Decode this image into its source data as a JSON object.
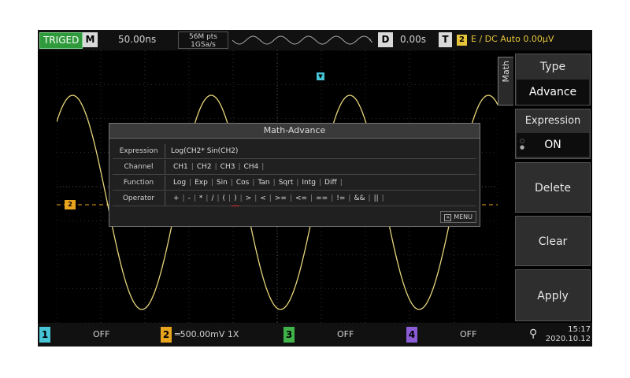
{
  "topbar": {
    "status": "TRIGED",
    "mode": "M",
    "timebase": "50.00ns",
    "points": "56M pts",
    "sample_rate": "1GSa/s",
    "d_label": "D",
    "delay": "0.00s",
    "t_label": "T",
    "trigger_channel": "2",
    "trigger_info": "E ∕ DC Auto 0.00μV"
  },
  "dialog": {
    "title": "Math-Advance",
    "rows": [
      {
        "label": "Expression",
        "value": "Log(CH2* Sin(CH2)"
      },
      {
        "label": "Channel",
        "tokens": [
          "CH1",
          "CH2",
          "CH3",
          "CH4"
        ]
      },
      {
        "label": "Function",
        "tokens": [
          "Log",
          "Exp",
          "Sin",
          "Cos",
          "Tan",
          "Sqrt",
          "Intg",
          "Diff"
        ]
      },
      {
        "label": "Operator",
        "tokens": [
          "+",
          "-",
          "*",
          "/",
          "(",
          ")",
          ">",
          "<",
          ">=",
          "<=",
          "==",
          "!=",
          "&&",
          "||"
        ],
        "selected_index": 5
      }
    ],
    "menu_label": "MENU"
  },
  "side_menu": {
    "tab": "Math",
    "items": [
      {
        "label": "Type",
        "value": "Advance"
      },
      {
        "label": "Expression",
        "value": "ON"
      },
      {
        "label": "Delete"
      },
      {
        "label": "Clear"
      },
      {
        "label": "Apply"
      }
    ]
  },
  "waveform": {
    "ch2_marker": "2",
    "color": "#e6d57a"
  },
  "bottombar": {
    "channels": [
      {
        "num": "1",
        "status": "OFF",
        "color": "#47c4d6"
      },
      {
        "num": "2",
        "status": "═500.00mV 1X",
        "color": "#e8a41e"
      },
      {
        "num": "3",
        "status": "OFF",
        "color": "#3fb24a"
      },
      {
        "num": "4",
        "status": "OFF",
        "color": "#8a5cd6"
      }
    ],
    "time": "15:17",
    "date": "2020.10.12"
  }
}
